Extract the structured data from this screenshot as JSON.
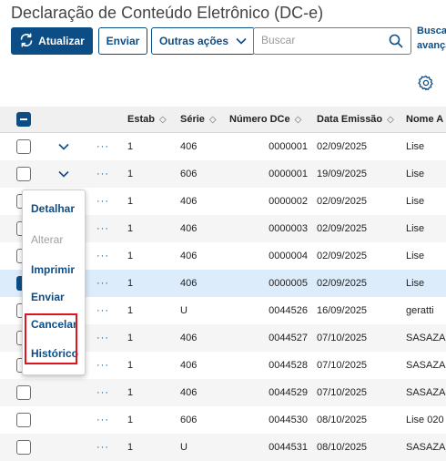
{
  "page": {
    "title": "Declaração de Conteúdo Eletrônico (DC-e)"
  },
  "toolbar": {
    "refresh_label": "Atualizar",
    "send_label": "Enviar",
    "more_actions_label": "Outras ações",
    "search_placeholder": "Buscar",
    "advanced_search_line1": "Busca",
    "advanced_search_line2": "avançada"
  },
  "table": {
    "columns": [
      "Estab",
      "Série",
      "Número DCe",
      "Data Emissão",
      "Nome A"
    ],
    "rows": [
      {
        "estab": "1",
        "serie": "406",
        "numero": "0000001",
        "data": "02/09/2025",
        "nome": "Lise"
      },
      {
        "estab": "1",
        "serie": "606",
        "numero": "0000001",
        "data": "19/09/2025",
        "nome": "Lise"
      },
      {
        "estab": "1",
        "serie": "406",
        "numero": "0000002",
        "data": "02/09/2025",
        "nome": "Lise"
      },
      {
        "estab": "1",
        "serie": "406",
        "numero": "0000003",
        "data": "02/09/2025",
        "nome": "Lise"
      },
      {
        "estab": "1",
        "serie": "406",
        "numero": "0000004",
        "data": "02/09/2025",
        "nome": "Lise"
      },
      {
        "estab": "1",
        "serie": "406",
        "numero": "0000005",
        "data": "02/09/2025",
        "nome": "Lise"
      },
      {
        "estab": "1",
        "serie": "U",
        "numero": "0044526",
        "data": "16/09/2025",
        "nome": "geratti"
      },
      {
        "estab": "1",
        "serie": "406",
        "numero": "0044527",
        "data": "07/10/2025",
        "nome": "SASAZA"
      },
      {
        "estab": "1",
        "serie": "406",
        "numero": "0044528",
        "data": "07/10/2025",
        "nome": "SASAZA"
      },
      {
        "estab": "1",
        "serie": "406",
        "numero": "0044529",
        "data": "07/10/2025",
        "nome": "SASAZA"
      },
      {
        "estab": "1",
        "serie": "606",
        "numero": "0044530",
        "data": "08/10/2025",
        "nome": "Lise 020"
      },
      {
        "estab": "1",
        "serie": "U",
        "numero": "0044531",
        "data": "08/10/2025",
        "nome": "SASAZA"
      }
    ]
  },
  "row_menu": {
    "items": [
      {
        "label": "Detalhar",
        "enabled": true
      },
      {
        "label": "Alterar",
        "enabled": false
      },
      {
        "label": "Imprimir",
        "enabled": true
      },
      {
        "label": "Enviar",
        "enabled": true
      },
      {
        "label": "Cancelar",
        "enabled": true
      },
      {
        "label": "Histórico",
        "enabled": true
      }
    ]
  },
  "icons": {
    "refresh": "refresh-icon",
    "chevron": "chevron-down-icon",
    "search": "search-icon",
    "settings": "gear-icon",
    "row_actions": "more-horizontal-icon"
  },
  "colors": {
    "primary": "#0c4d86",
    "selected_row": "#dcecfb",
    "highlight": "#e0141e"
  }
}
